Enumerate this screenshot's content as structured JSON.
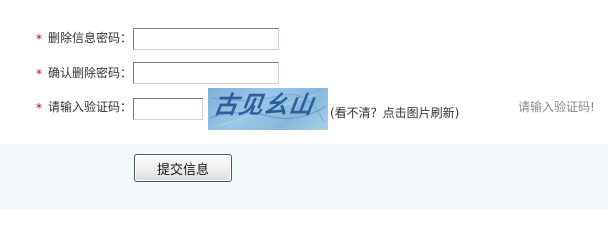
{
  "form": {
    "required_mark": "*",
    "delete_password": {
      "label": "删除信息密码：",
      "value": ""
    },
    "confirm_password": {
      "label": "确认删除密码：",
      "value": ""
    },
    "captcha": {
      "label": "请输入验证码：",
      "value": "",
      "image_text": "古见幺山",
      "refresh_hint": "(看不清？点击图片刷新)",
      "side_hint": "请输入验证码!"
    },
    "submit_label": "提交信息"
  },
  "colors": {
    "required": "#cc0000",
    "footer_band": "#f3f9fb",
    "captcha_bg": "#8fbfe0",
    "captcha_text": "#2c5d9e",
    "side_hint": "#888888"
  }
}
